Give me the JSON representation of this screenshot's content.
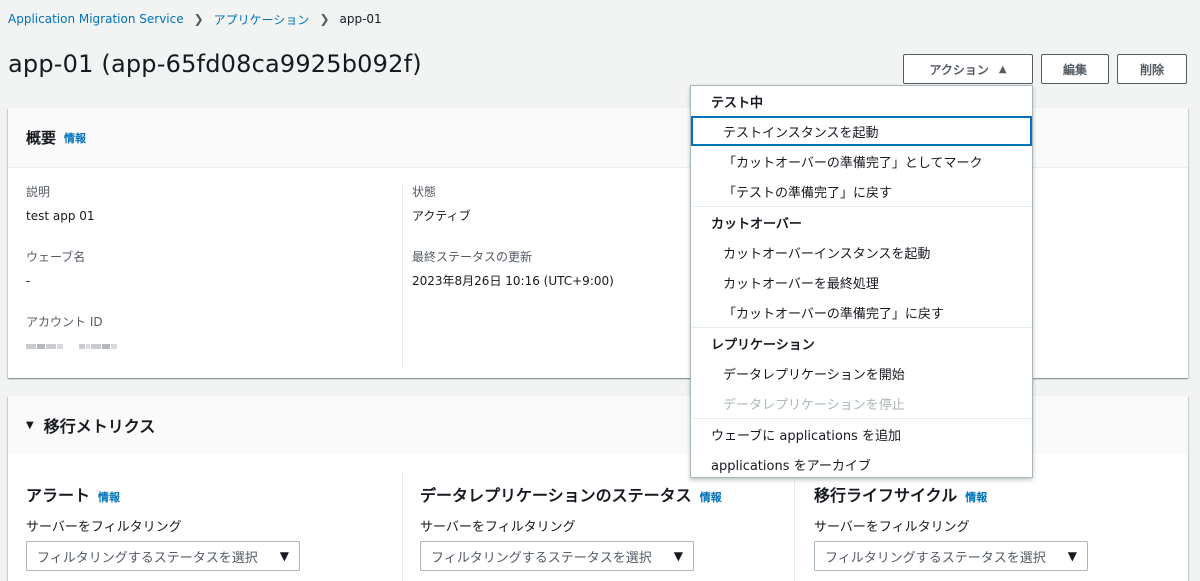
{
  "breadcrumb": {
    "items": [
      "Application Migration Service",
      "アプリケーション"
    ],
    "current": "app-01"
  },
  "page": {
    "title": "app-01 (app-65fd08ca9925b092f)"
  },
  "header_buttons": {
    "actions_label": "アクション",
    "edit_label": "編集",
    "delete_label": "削除"
  },
  "summary": {
    "title": "概要",
    "info": "情報",
    "description_label": "説明",
    "description_value": "test app 01",
    "wave_label": "ウェーブ名",
    "wave_value": "-",
    "account_label": "アカウント ID",
    "status_label": "状態",
    "status_value": "アクティブ",
    "last_updated_label": "最終ステータスの更新",
    "last_updated_value": "2023年8月26日 10:16 (UTC+9:00)"
  },
  "metrics": {
    "title": "移行メトリクス",
    "columns": [
      {
        "title": "アラート",
        "info": "情報",
        "filter_label": "サーバーをフィルタリング",
        "select_placeholder": "フィルタリングするステータスを選択"
      },
      {
        "title": "データレプリケーションのステータス",
        "info": "情報",
        "filter_label": "サーバーをフィルタリング",
        "select_placeholder": "フィルタリングするステータスを選択"
      },
      {
        "title": "移行ライフサイクル",
        "info": "情報",
        "filter_label": "サーバーをフィルタリング",
        "select_placeholder": "フィルタリングするステータスを選択"
      }
    ]
  },
  "actions_menu": {
    "testing": {
      "header": "テスト中",
      "items": [
        "テストインスタンスを起動",
        "「カットオーバーの準備完了」としてマーク",
        "「テストの準備完了」に戻す"
      ]
    },
    "cutover": {
      "header": "カットオーバー",
      "items": [
        "カットオーバーインスタンスを起動",
        "カットオーバーを最終処理",
        "「カットオーバーの準備完了」に戻す"
      ]
    },
    "replication": {
      "header": "レプリケーション",
      "items": [
        "データレプリケーションを開始",
        "データレプリケーションを停止"
      ]
    },
    "other": {
      "items": [
        "ウェーブに applications を追加",
        "applications をアーカイブ"
      ]
    }
  },
  "colors": {
    "link": "#0073bb",
    "focus_ring": "#0073bb",
    "disabled_text": "#aab7b8"
  }
}
